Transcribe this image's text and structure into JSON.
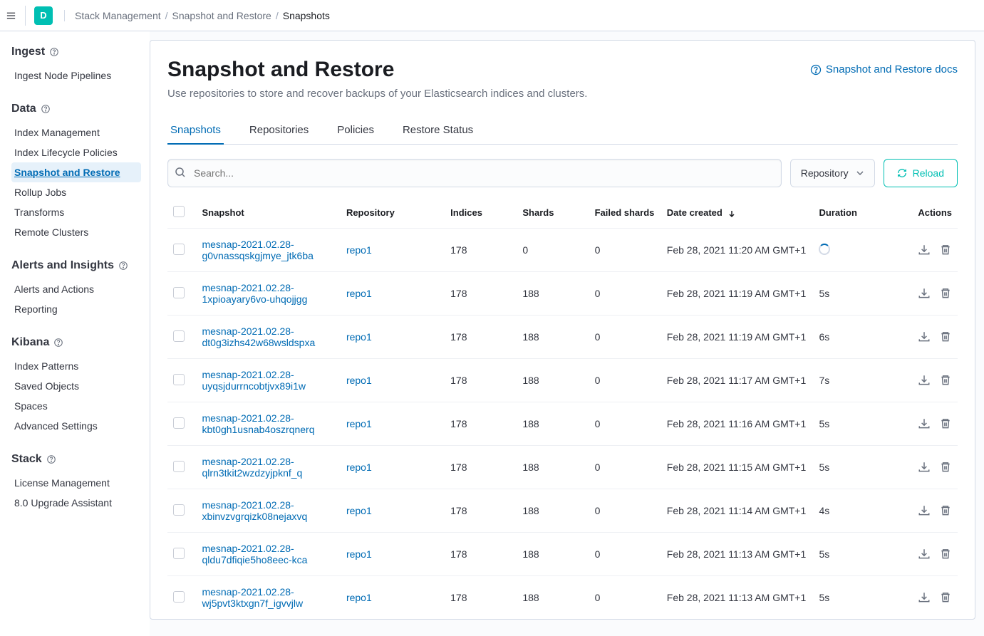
{
  "header": {
    "logo_letter": "D",
    "breadcrumbs": [
      "Stack Management",
      "Snapshot and Restore",
      "Snapshots"
    ]
  },
  "sidebar": {
    "sections": [
      {
        "title": "Ingest",
        "items": [
          {
            "label": "Ingest Node Pipelines",
            "active": false
          }
        ]
      },
      {
        "title": "Data",
        "items": [
          {
            "label": "Index Management",
            "active": false
          },
          {
            "label": "Index Lifecycle Policies",
            "active": false
          },
          {
            "label": "Snapshot and Restore",
            "active": true
          },
          {
            "label": "Rollup Jobs",
            "active": false
          },
          {
            "label": "Transforms",
            "active": false
          },
          {
            "label": "Remote Clusters",
            "active": false
          }
        ]
      },
      {
        "title": "Alerts and Insights",
        "items": [
          {
            "label": "Alerts and Actions",
            "active": false
          },
          {
            "label": "Reporting",
            "active": false
          }
        ]
      },
      {
        "title": "Kibana",
        "items": [
          {
            "label": "Index Patterns",
            "active": false
          },
          {
            "label": "Saved Objects",
            "active": false
          },
          {
            "label": "Spaces",
            "active": false
          },
          {
            "label": "Advanced Settings",
            "active": false
          }
        ]
      },
      {
        "title": "Stack",
        "items": [
          {
            "label": "License Management",
            "active": false
          },
          {
            "label": "8.0 Upgrade Assistant",
            "active": false
          }
        ]
      }
    ]
  },
  "page": {
    "title": "Snapshot and Restore",
    "subtitle": "Use repositories to store and recover backups of your Elasticsearch indices and clusters.",
    "docs_link": "Snapshot and Restore docs",
    "tabs": [
      "Snapshots",
      "Repositories",
      "Policies",
      "Restore Status"
    ],
    "active_tab": 0,
    "search_placeholder": "Search...",
    "repo_filter_label": "Repository",
    "reload_label": "Reload",
    "columns": [
      "Snapshot",
      "Repository",
      "Indices",
      "Shards",
      "Failed shards",
      "Date created",
      "Duration",
      "Actions"
    ],
    "sorted_column": "Date created",
    "sort_direction": "desc",
    "rows": [
      {
        "snapshot": "mesnap-2021.02.28-g0vnassqskgjmye_jtk6ba",
        "repo": "repo1",
        "indices": "178",
        "shards": "0",
        "failed": "0",
        "date": "Feb 28, 2021 11:20 AM GMT+1",
        "duration": "__SPINNER__"
      },
      {
        "snapshot": "mesnap-2021.02.28-1xpioayary6vo-uhqojjgg",
        "repo": "repo1",
        "indices": "178",
        "shards": "188",
        "failed": "0",
        "date": "Feb 28, 2021 11:19 AM GMT+1",
        "duration": "5s"
      },
      {
        "snapshot": "mesnap-2021.02.28-dt0g3izhs42w68wsldspxa",
        "repo": "repo1",
        "indices": "178",
        "shards": "188",
        "failed": "0",
        "date": "Feb 28, 2021 11:19 AM GMT+1",
        "duration": "6s"
      },
      {
        "snapshot": "mesnap-2021.02.28-uyqsjdurrncobtjvx89i1w",
        "repo": "repo1",
        "indices": "178",
        "shards": "188",
        "failed": "0",
        "date": "Feb 28, 2021 11:17 AM GMT+1",
        "duration": "7s"
      },
      {
        "snapshot": "mesnap-2021.02.28-kbt0gh1usnab4oszrqnerq",
        "repo": "repo1",
        "indices": "178",
        "shards": "188",
        "failed": "0",
        "date": "Feb 28, 2021 11:16 AM GMT+1",
        "duration": "5s"
      },
      {
        "snapshot": "mesnap-2021.02.28-qlrn3tkit2wzdzyjpknf_q",
        "repo": "repo1",
        "indices": "178",
        "shards": "188",
        "failed": "0",
        "date": "Feb 28, 2021 11:15 AM GMT+1",
        "duration": "5s"
      },
      {
        "snapshot": "mesnap-2021.02.28-xbinvzvgrqizk08nejaxvq",
        "repo": "repo1",
        "indices": "178",
        "shards": "188",
        "failed": "0",
        "date": "Feb 28, 2021 11:14 AM GMT+1",
        "duration": "4s"
      },
      {
        "snapshot": "mesnap-2021.02.28-qldu7dfiqie5ho8eec-kca",
        "repo": "repo1",
        "indices": "178",
        "shards": "188",
        "failed": "0",
        "date": "Feb 28, 2021 11:13 AM GMT+1",
        "duration": "5s"
      },
      {
        "snapshot": "mesnap-2021.02.28-wj5pvt3ktxgn7f_igvvjlw",
        "repo": "repo1",
        "indices": "178",
        "shards": "188",
        "failed": "0",
        "date": "Feb 28, 2021 11:13 AM GMT+1",
        "duration": "5s"
      }
    ]
  }
}
